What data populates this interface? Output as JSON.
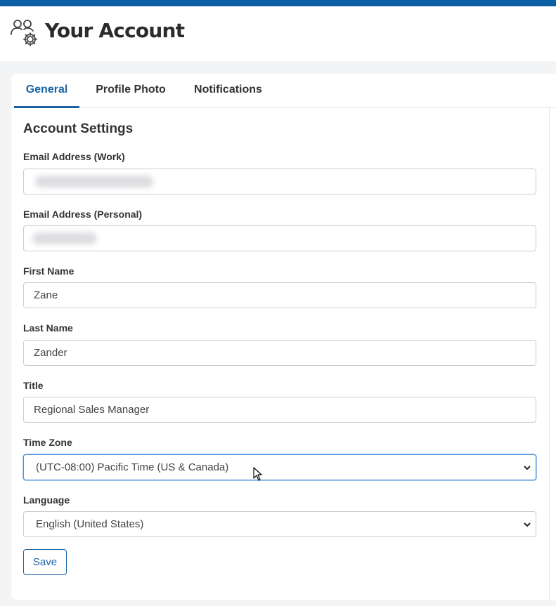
{
  "header": {
    "title": "Your Account",
    "icon": "user-settings-icon"
  },
  "tabs": [
    {
      "label": "General",
      "active": true
    },
    {
      "label": "Profile Photo",
      "active": false
    },
    {
      "label": "Notifications",
      "active": false
    }
  ],
  "section_title": "Account Settings",
  "form": {
    "email_work": {
      "label": "Email Address (Work)",
      "value": ""
    },
    "email_personal": {
      "label": "Email Address (Personal)",
      "value": ""
    },
    "first_name": {
      "label": "First Name",
      "value": "Zane"
    },
    "last_name": {
      "label": "Last Name",
      "value": "Zander"
    },
    "title": {
      "label": "Title",
      "value": "Regional Sales Manager"
    },
    "time_zone": {
      "label": "Time Zone",
      "value": "(UTC-08:00) Pacific Time (US & Canada)"
    },
    "language": {
      "label": "Language",
      "value": "English (United States)"
    }
  },
  "save_label": "Save",
  "colors": {
    "accent": "#1a64a6",
    "topbar": "#0b5fa5",
    "background": "#f3f4f6"
  }
}
